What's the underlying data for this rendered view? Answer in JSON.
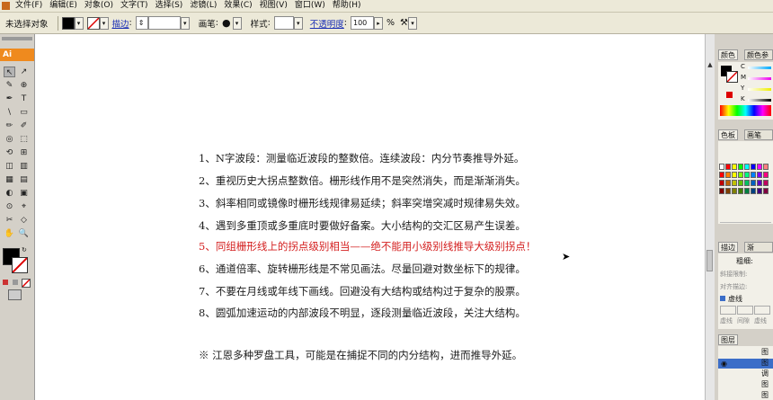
{
  "menu": {
    "items": [
      "文件(F)",
      "编辑(E)",
      "对象(O)",
      "文字(T)",
      "选择(S)",
      "滤镜(L)",
      "效果(C)",
      "视图(V)",
      "窗口(W)",
      "帮助(H)"
    ]
  },
  "control_bar": {
    "selection_status": "未选择对象",
    "stroke_link": "描边",
    "brush_label": "画笔",
    "style_label": "样式",
    "opacity_link": "不透明度",
    "opacity_value": "100",
    "percent": "%"
  },
  "toolbox": {
    "logo": "Ai",
    "tools": [
      "↖",
      "↗",
      "✎",
      "⊕",
      "✒",
      "T",
      "\\",
      "▭",
      "✏",
      "✐",
      "◎",
      "⬚",
      "⟲",
      "⊞",
      "◫",
      "▥",
      "▦",
      "▤",
      "◐",
      "▣",
      "⊙",
      "⌖",
      "✂",
      "◇",
      "✋",
      "🔍"
    ]
  },
  "document": {
    "lines": [
      "1、N字波段：测量临近波段的整数倍。连续波段：内分节奏推导外延。",
      "2、重视历史大拐点整数倍。栅形线作用不是突然消失，而是渐渐消失。",
      "3、斜率相同或镜像时栅形线规律易延续；斜率突增突减时规律易失效。",
      "4、遇到多重顶或多重底时要做好备案。大小结构的交汇区易产生误差。",
      "5、同组栅形线上的拐点级别相当——绝不能用小级别线推导大级别拐点！",
      "6、通道倍率、旋转栅形线是不常见画法。尽量回避对数坐标下的规律。",
      "7、不要在月线或年线下画线。回避没有大结构或结构过于复杂的股票。",
      "8、圆弧加速运动的内部波段不明显，逐段测量临近波段，关注大结构。",
      "※ 江恩多种罗盘工具，可能是在捕捉不同的内分结构，进而推导外延。"
    ],
    "highlight_color": "#d42020"
  },
  "panels": {
    "color_tabs": [
      "颜色",
      "颜色参"
    ],
    "color_channels": [
      "C",
      "M",
      "Y",
      "K"
    ],
    "swatch_tabs": [
      "色板",
      "画笔"
    ],
    "stroke_tabs": [
      "描边",
      "渐"
    ],
    "stroke_weight_label": "粗细:",
    "stroke_rows": [
      "斜接限制:",
      "对齐描边:"
    ],
    "dashed_label": "虚线",
    "dash_labels": [
      "虚线",
      "间隙",
      "虚线"
    ],
    "layers_tab": "图层",
    "layer_items": [
      "图",
      "图",
      "调",
      "图",
      "图"
    ]
  },
  "colors": {
    "swatches": [
      "#ffffff",
      "#ff0000",
      "#ffff00",
      "#00ff00",
      "#00ffff",
      "#0000ff",
      "#ff00ff",
      "#ff8080",
      "#ff0000",
      "#ff8000",
      "#ffff00",
      "#80ff00",
      "#00ff80",
      "#0080ff",
      "#8000ff",
      "#ff0080",
      "#c00000",
      "#c06000",
      "#c0c000",
      "#60c000",
      "#00c060",
      "#0060c0",
      "#6000c0",
      "#c00060",
      "#800000",
      "#804000",
      "#808000",
      "#408000",
      "#008040",
      "#004080",
      "#400080",
      "#800040"
    ]
  }
}
